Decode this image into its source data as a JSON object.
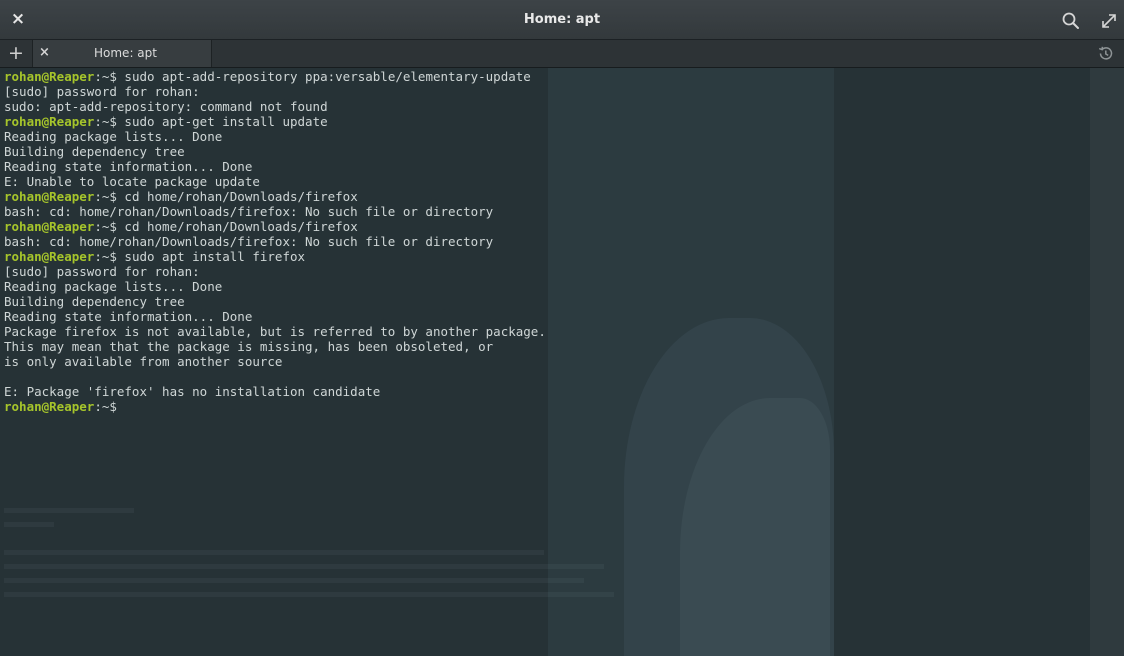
{
  "window": {
    "title": "Home: apt",
    "close_label": "×"
  },
  "tabs": [
    {
      "label": "Home: apt",
      "close_label": "×"
    }
  ],
  "new_tab_label": "+",
  "icons": {
    "window_close": "close-icon",
    "search": "search-icon",
    "maximize": "maximize-icon",
    "new_tab": "plus-icon",
    "tab_close": "close-icon",
    "history": "history-icon"
  },
  "colors": {
    "prompt": "#a6c52b",
    "text": "#cfd6d6",
    "background": "#263236"
  },
  "terminal": {
    "lines": [
      {
        "prompt": "rohan@Reaper",
        "path": ":~$ ",
        "text": "sudo apt-add-repository ppa:versable/elementary-update"
      },
      {
        "text": "[sudo] password for rohan:"
      },
      {
        "text": "sudo: apt-add-repository: command not found"
      },
      {
        "prompt": "rohan@Reaper",
        "path": ":~$ ",
        "text": "sudo apt-get install update"
      },
      {
        "text": "Reading package lists... Done"
      },
      {
        "text": "Building dependency tree"
      },
      {
        "text": "Reading state information... Done"
      },
      {
        "text": "E: Unable to locate package update"
      },
      {
        "prompt": "rohan@Reaper",
        "path": ":~$ ",
        "text": "cd home/rohan/Downloads/firefox"
      },
      {
        "text": "bash: cd: home/rohan/Downloads/firefox: No such file or directory"
      },
      {
        "prompt": "rohan@Reaper",
        "path": ":~$ ",
        "text": "cd home/rohan/Downloads/firefox"
      },
      {
        "text": "bash: cd: home/rohan/Downloads/firefox: No such file or directory"
      },
      {
        "prompt": "rohan@Reaper",
        "path": ":~$ ",
        "text": "sudo apt install firefox"
      },
      {
        "text": "[sudo] password for rohan:"
      },
      {
        "text": "Reading package lists... Done"
      },
      {
        "text": "Building dependency tree"
      },
      {
        "text": "Reading state information... Done"
      },
      {
        "text": "Package firefox is not available, but is referred to by another package."
      },
      {
        "text": "This may mean that the package is missing, has been obsoleted, or"
      },
      {
        "text": "is only available from another source"
      },
      {
        "text": ""
      },
      {
        "text": "E: Package 'firefox' has no installation candidate"
      },
      {
        "prompt": "rohan@Reaper",
        "path": ":~$",
        "text": ""
      }
    ]
  }
}
